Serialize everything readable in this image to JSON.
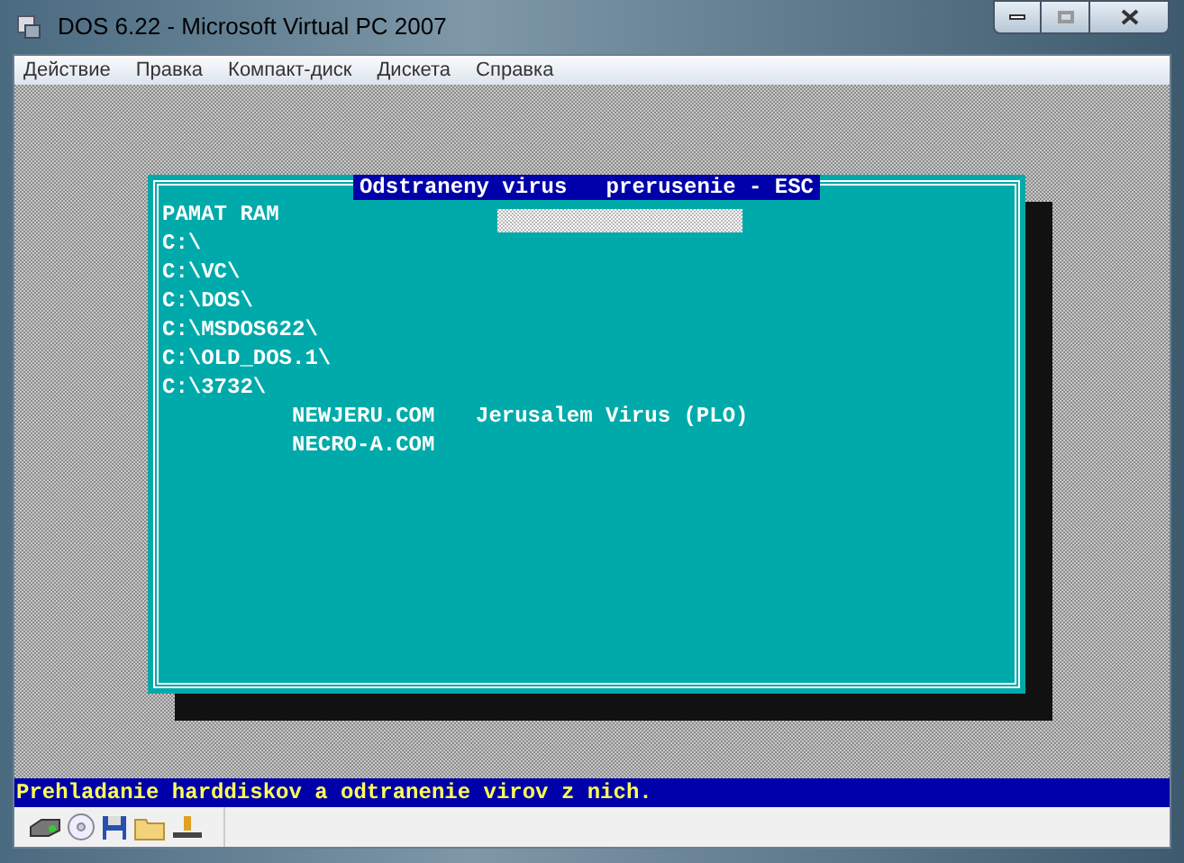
{
  "window": {
    "title": "DOS 6.22 - Microsoft Virtual PC 2007"
  },
  "menu": [
    "Действие",
    "Правка",
    "Компакт-диск",
    "Дискета",
    "Справка"
  ],
  "dialog": {
    "title": "Odstraneny virus   prerusenie - ESC",
    "lines": [
      {
        "path": "PAMAT RAM"
      },
      {
        "path": "C:\\"
      },
      {
        "path": "C:\\VC\\"
      },
      {
        "path": "C:\\DOS\\"
      },
      {
        "path": "C:\\MSDOS622\\"
      },
      {
        "path": "C:\\OLD_DOS.1\\"
      },
      {
        "path": "C:\\3732\\",
        "files": [
          {
            "name": "NEWJERU.COM",
            "virus": "Jerusalem Virus (PLO)"
          },
          {
            "name": "NECRO-A.COM"
          }
        ]
      }
    ]
  },
  "status_line": "Prehladanie harddiskov a odtranenie virov z nich."
}
